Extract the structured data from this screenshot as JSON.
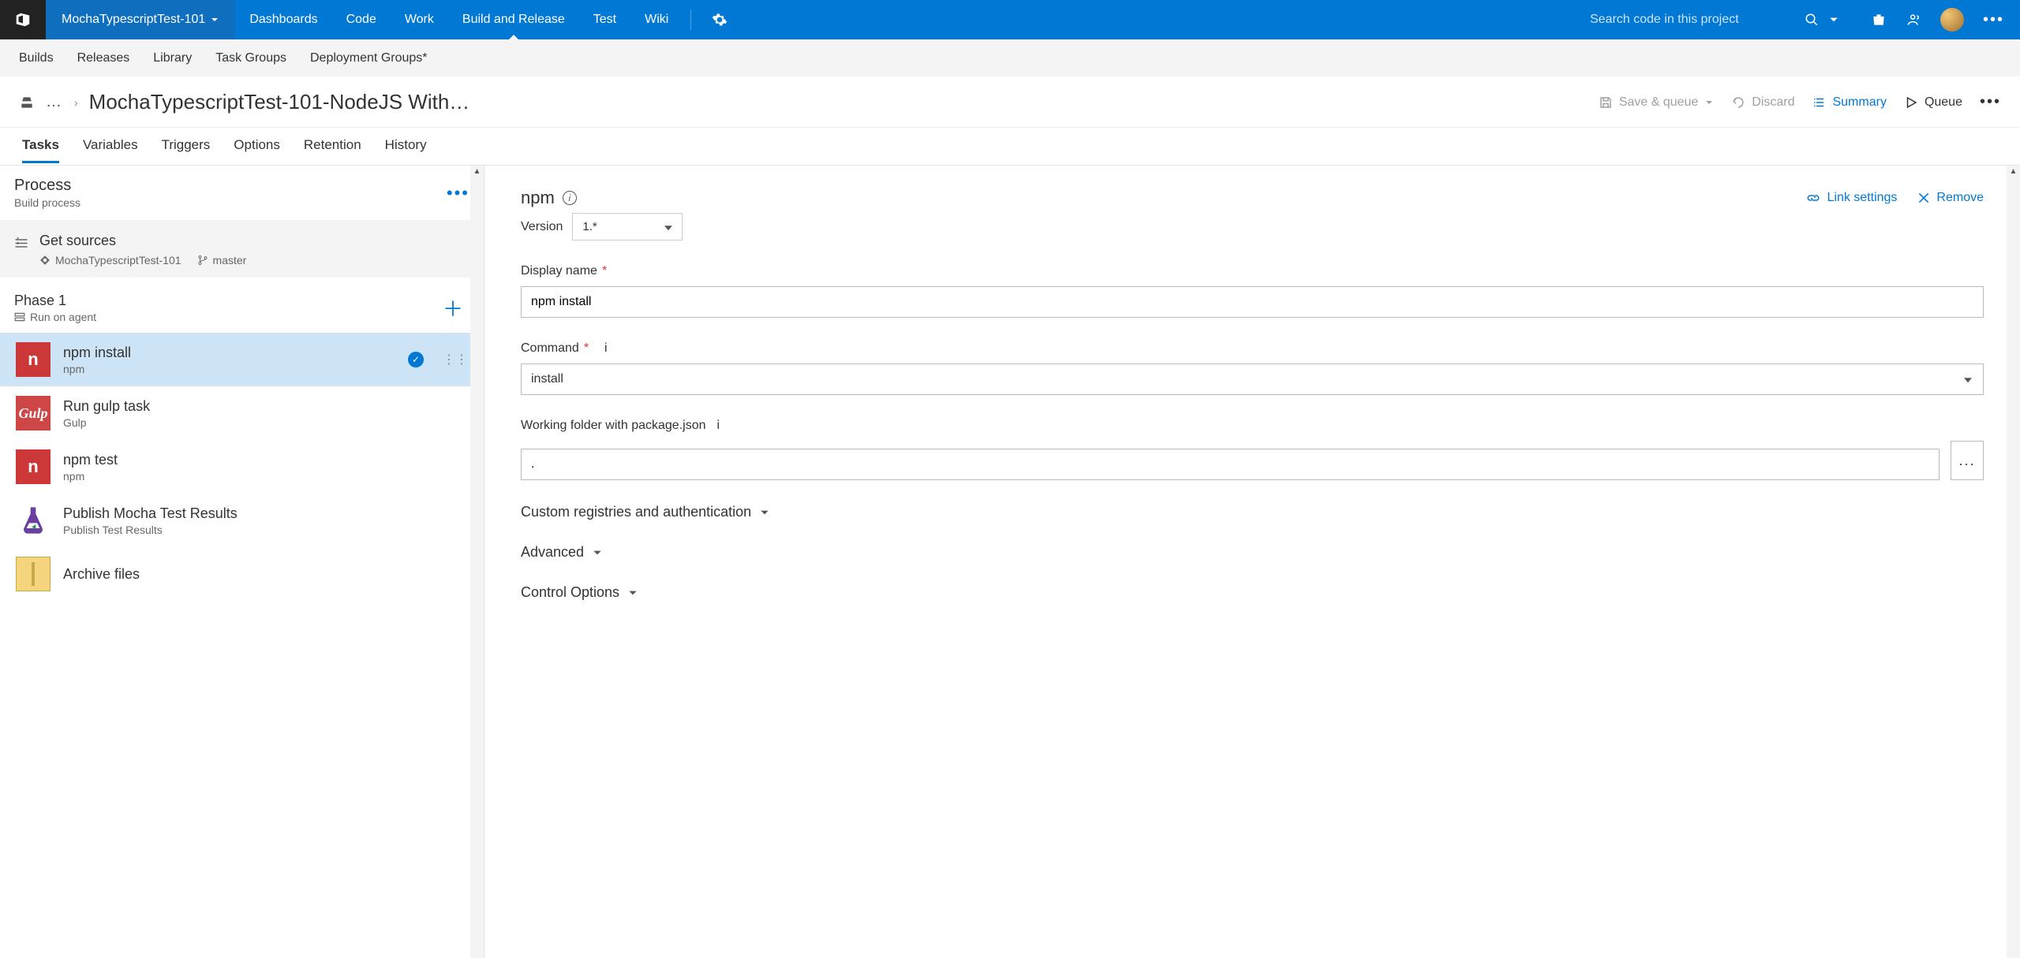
{
  "topbar": {
    "project_name": "MochaTypescriptTest-101",
    "nav": [
      "Dashboards",
      "Code",
      "Work",
      "Build and Release",
      "Test",
      "Wiki"
    ],
    "active_nav_index": 3,
    "search_placeholder": "Search code in this project"
  },
  "subnav": [
    "Builds",
    "Releases",
    "Library",
    "Task Groups",
    "Deployment Groups*"
  ],
  "page": {
    "title": "MochaTypescriptTest-101-NodeJS With…",
    "actions": {
      "save_queue": "Save & queue",
      "discard": "Discard",
      "summary": "Summary",
      "queue": "Queue"
    }
  },
  "tabs": [
    "Tasks",
    "Variables",
    "Triggers",
    "Options",
    "Retention",
    "History"
  ],
  "active_tab_index": 0,
  "left": {
    "process_title": "Process",
    "process_sub": "Build process",
    "sources_title": "Get sources",
    "sources_repo": "MochaTypescriptTest-101",
    "sources_branch": "master",
    "phase_title": "Phase 1",
    "phase_sub": "Run on agent",
    "tasks": [
      {
        "name": "npm install",
        "sub": "npm",
        "icon": "npm",
        "selected": true
      },
      {
        "name": "Run gulp task",
        "sub": "Gulp",
        "icon": "gulp",
        "selected": false
      },
      {
        "name": "npm test",
        "sub": "npm",
        "icon": "npm",
        "selected": false
      },
      {
        "name": "Publish Mocha Test Results",
        "sub": "Publish Test Results",
        "icon": "flask",
        "selected": false
      },
      {
        "name": "Archive files",
        "sub": "",
        "icon": "archive",
        "selected": false
      }
    ]
  },
  "detail": {
    "title": "npm",
    "version_label": "Version",
    "version_value": "1.*",
    "link_settings": "Link settings",
    "remove": "Remove",
    "display_name_label": "Display name",
    "display_name_value": "npm install",
    "command_label": "Command",
    "command_value": "install",
    "working_folder_label": "Working folder with package.json",
    "working_folder_value": ".",
    "sections": [
      "Custom registries and authentication",
      "Advanced",
      "Control Options"
    ]
  }
}
